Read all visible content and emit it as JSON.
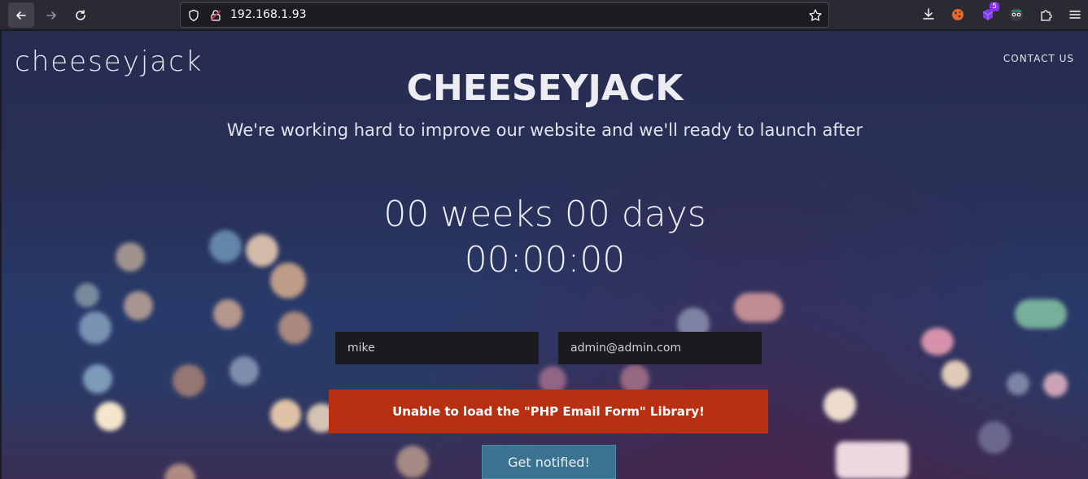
{
  "browser": {
    "url": "192.168.1.93",
    "toolbar_badge": "5"
  },
  "site": {
    "logo": "cheeseyjack",
    "nav_contact": "CONTACT US",
    "title": "CHEESEYJACK",
    "subtitle": "We're working hard to improve our website and we'll ready to launch after",
    "countdown_line1": "00 weeks 00 days",
    "countdown_line2": "00:00:00",
    "name_value": "mike",
    "email_value": "admin@admin.com",
    "error_message": "Unable to load the \"PHP Email Form\" Library!",
    "notify_label": "Get notified!"
  },
  "colors": {
    "error_bg": "#b92f12",
    "button_bg": "#3a738f",
    "page_bg": "#28315a"
  }
}
